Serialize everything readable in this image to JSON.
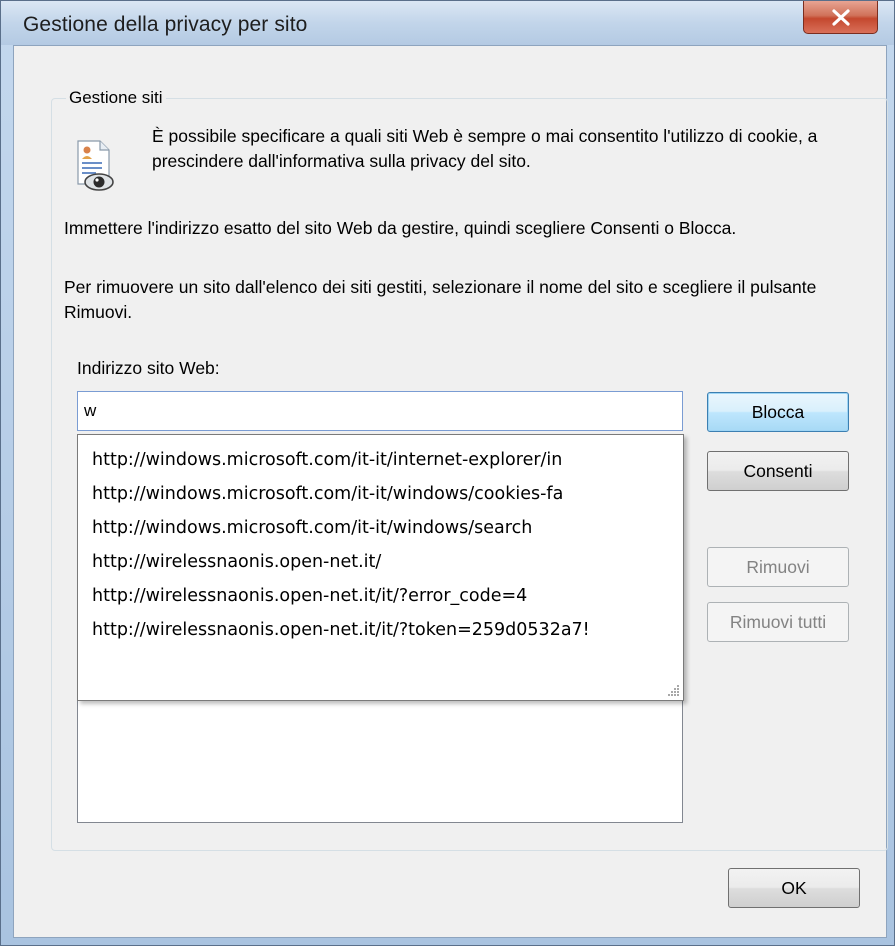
{
  "window": {
    "title": "Gestione della privacy per sito",
    "close_icon": "close-icon"
  },
  "group": {
    "legend": "Gestione siti",
    "icon": "privacy-eye-document-icon",
    "description": "È possibile specificare a quali siti Web è sempre o mai consentito l'utilizzo di cookie, a prescindere dall'informativa sulla privacy del sito.",
    "para1": "Immettere l'indirizzo esatto del sito Web da gestire, quindi scegliere Consenti o Blocca.",
    "para2": "Per rimuovere un sito dall'elenco dei siti gestiti, selezionare il nome del sito e scegliere il pulsante Rimuovi.",
    "address_label": "Indirizzo sito Web:",
    "address_value": "w"
  },
  "autocomplete": {
    "items": [
      "http://windows.microsoft.com/it-it/internet-explorer/in",
      "http://windows.microsoft.com/it-it/windows/cookies-fa",
      "http://windows.microsoft.com/it-it/windows/search",
      "http://wirelessnaonis.open-net.it/",
      "http://wirelessnaonis.open-net.it/it/?error_code=4",
      "http://wirelessnaonis.open-net.it/it/?token=259d0532a7!"
    ],
    "resize_icon": "resize-grip-icon"
  },
  "buttons": {
    "block": "Blocca",
    "allow": "Consenti",
    "remove": "Rimuovi",
    "remove_all": "Rimuovi tutti",
    "ok": "OK"
  }
}
